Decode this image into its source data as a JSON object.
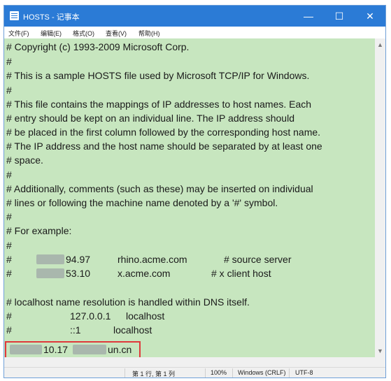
{
  "window": {
    "title": "HOSTS - 记事本"
  },
  "controls": {
    "minimize": "—",
    "maximize": "☐",
    "close": "✕"
  },
  "menu": [
    "文件(F)",
    "编辑(E)",
    "格式(O)",
    "查看(V)",
    "帮助(H)"
  ],
  "lines": [
    "# Copyright (c) 1993-2009 Microsoft Corp.",
    "#",
    "# This is a sample HOSTS file used by Microsoft TCP/IP for Windows.",
    "#",
    "# This file contains the mappings of IP addresses to host names. Each",
    "# entry should be kept on an individual line. The IP address should",
    "# be placed in the first column followed by the corresponding host name.",
    "# The IP address and the host name should be separated by at least one",
    "# space.",
    "#",
    "# Additionally, comments (such as these) may be inserted on individual",
    "# lines or following the machine name denoted by a '#' symbol.",
    "#",
    "# For example:",
    "#"
  ],
  "examples": [
    {
      "hash": "#",
      "ip": "94.97",
      "host": "rhino.acme.com",
      "comment": "# source server"
    },
    {
      "hash": "#",
      "ip": "53.10",
      "host": "x.acme.com",
      "comment": "# x client host"
    }
  ],
  "localhost_comment": "# localhost name resolution is handled within DNS itself.",
  "localhost_entries": [
    {
      "hash": "#",
      "ip": "127.0.0.1",
      "host": "localhost"
    },
    {
      "hash": "#",
      "ip": "::1",
      "host": "localhost"
    }
  ],
  "custom_entry": {
    "ip": "10.17",
    "host": "un.cn"
  },
  "scrollbar": {
    "up": "▲",
    "down": "▼"
  },
  "status": {
    "position": "第 1 行, 第 1 列",
    "zoom": "100%",
    "line_ending": "Windows (CRLF)",
    "encoding": "UTF-8"
  },
  "colors": {
    "titlebar": "#2b7bd6",
    "editor_background": "#c7e6bf",
    "highlight_border": "#e0383b"
  }
}
